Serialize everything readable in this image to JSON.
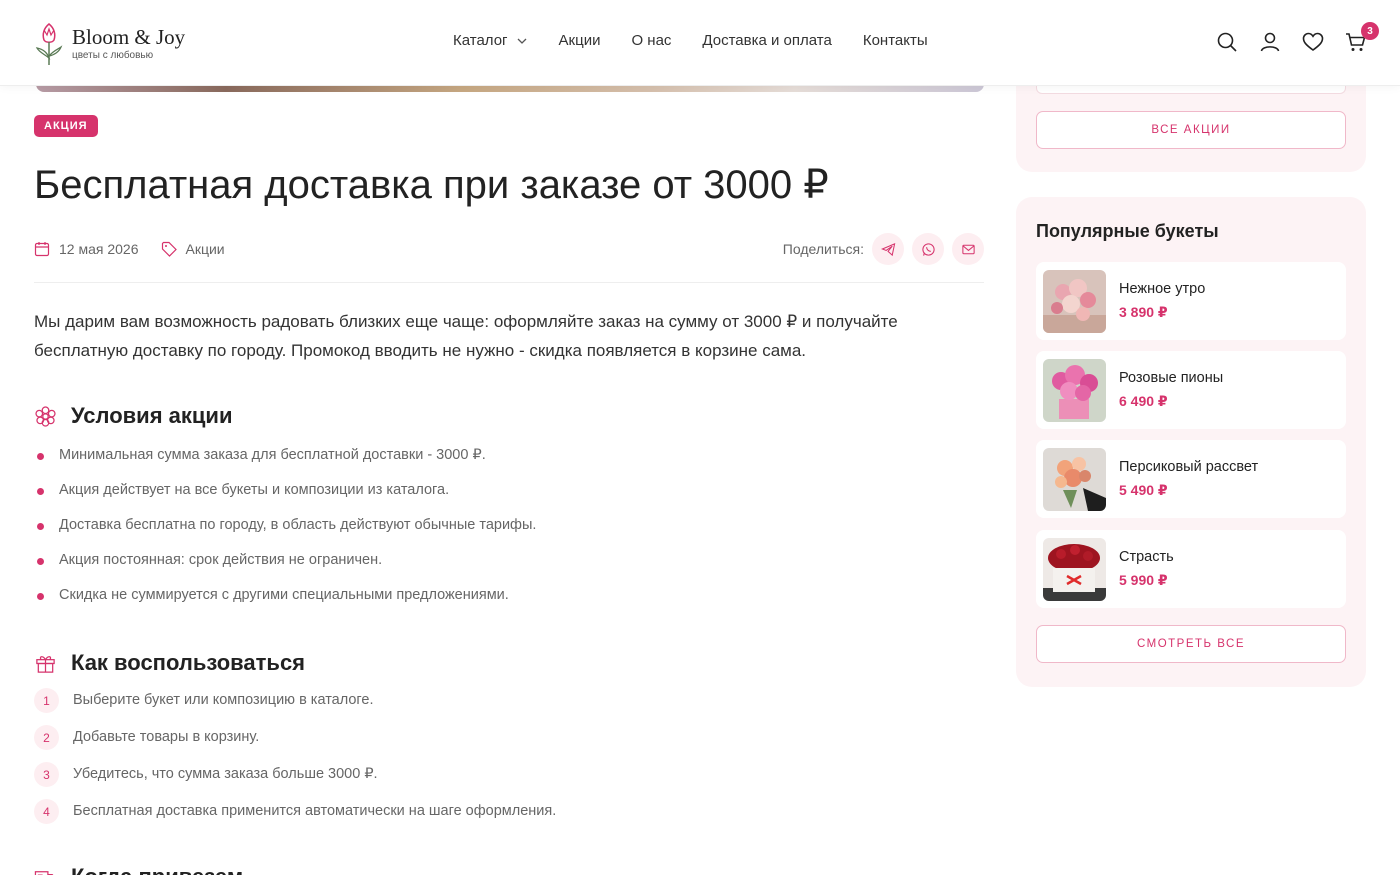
{
  "brand": {
    "name": "Bloom & Joy",
    "tagline": "цветы с любовью"
  },
  "nav": {
    "catalog": "Каталог",
    "promos": "Акции",
    "about": "О нас",
    "delivery": "Доставка и оплата",
    "contacts": "Контакты"
  },
  "header": {
    "cart_count": "3"
  },
  "article": {
    "badge": "АКЦИЯ",
    "title": "Бесплатная доставка при заказе от 3000 ₽",
    "date": "12 мая 2026",
    "category": "Акции",
    "share_label": "Поделиться:",
    "intro": "Мы дарим вам возможность радовать близких еще чаще: оформляйте заказ на сумму от 3000 ₽ и получайте бесплатную доставку по городу. Промокод вводить не нужно - скидка появляется в корзине сама.",
    "conditions_title": "Условия акции",
    "conditions": [
      "Минимальная сумма заказа для бесплатной доставки - 3000 ₽.",
      "Акция действует на все букеты и композиции из каталога.",
      "Доставка бесплатна по городу, в область действуют обычные тарифы.",
      "Акция постоянная: срок действия не ограничен.",
      "Скидка не суммируется с другими специальными предложениями."
    ],
    "howto_title": "Как воспользоваться",
    "steps": [
      {
        "num": "1",
        "text": "Выберите букет или композицию в каталоге."
      },
      {
        "num": "2",
        "text": "Добавьте товары в корзину."
      },
      {
        "num": "3",
        "text": "Убедитесь, что сумма заказа больше 3000 ₽."
      },
      {
        "num": "4",
        "text": "Бесплатная доставка применится автоматически на шаге оформления."
      }
    ],
    "delivery_title": "Когда привезем"
  },
  "sidebar": {
    "all_promos": "ВСЕ АКЦИИ",
    "popular_title": "Популярные букеты",
    "bouquets": [
      {
        "name": "Нежное утро",
        "price": "3 890 ₽"
      },
      {
        "name": "Розовые пионы",
        "price": "6 490 ₽"
      },
      {
        "name": "Персиковый рассвет",
        "price": "5 490 ₽"
      },
      {
        "name": "Страсть",
        "price": "5 990 ₽"
      }
    ],
    "view_all": "СМОТРЕТЬ ВСЕ"
  },
  "colors": {
    "accent": "#d6336c",
    "accent_soft": "#fdeef1",
    "sidebar_bg": "#fdf3f5"
  }
}
